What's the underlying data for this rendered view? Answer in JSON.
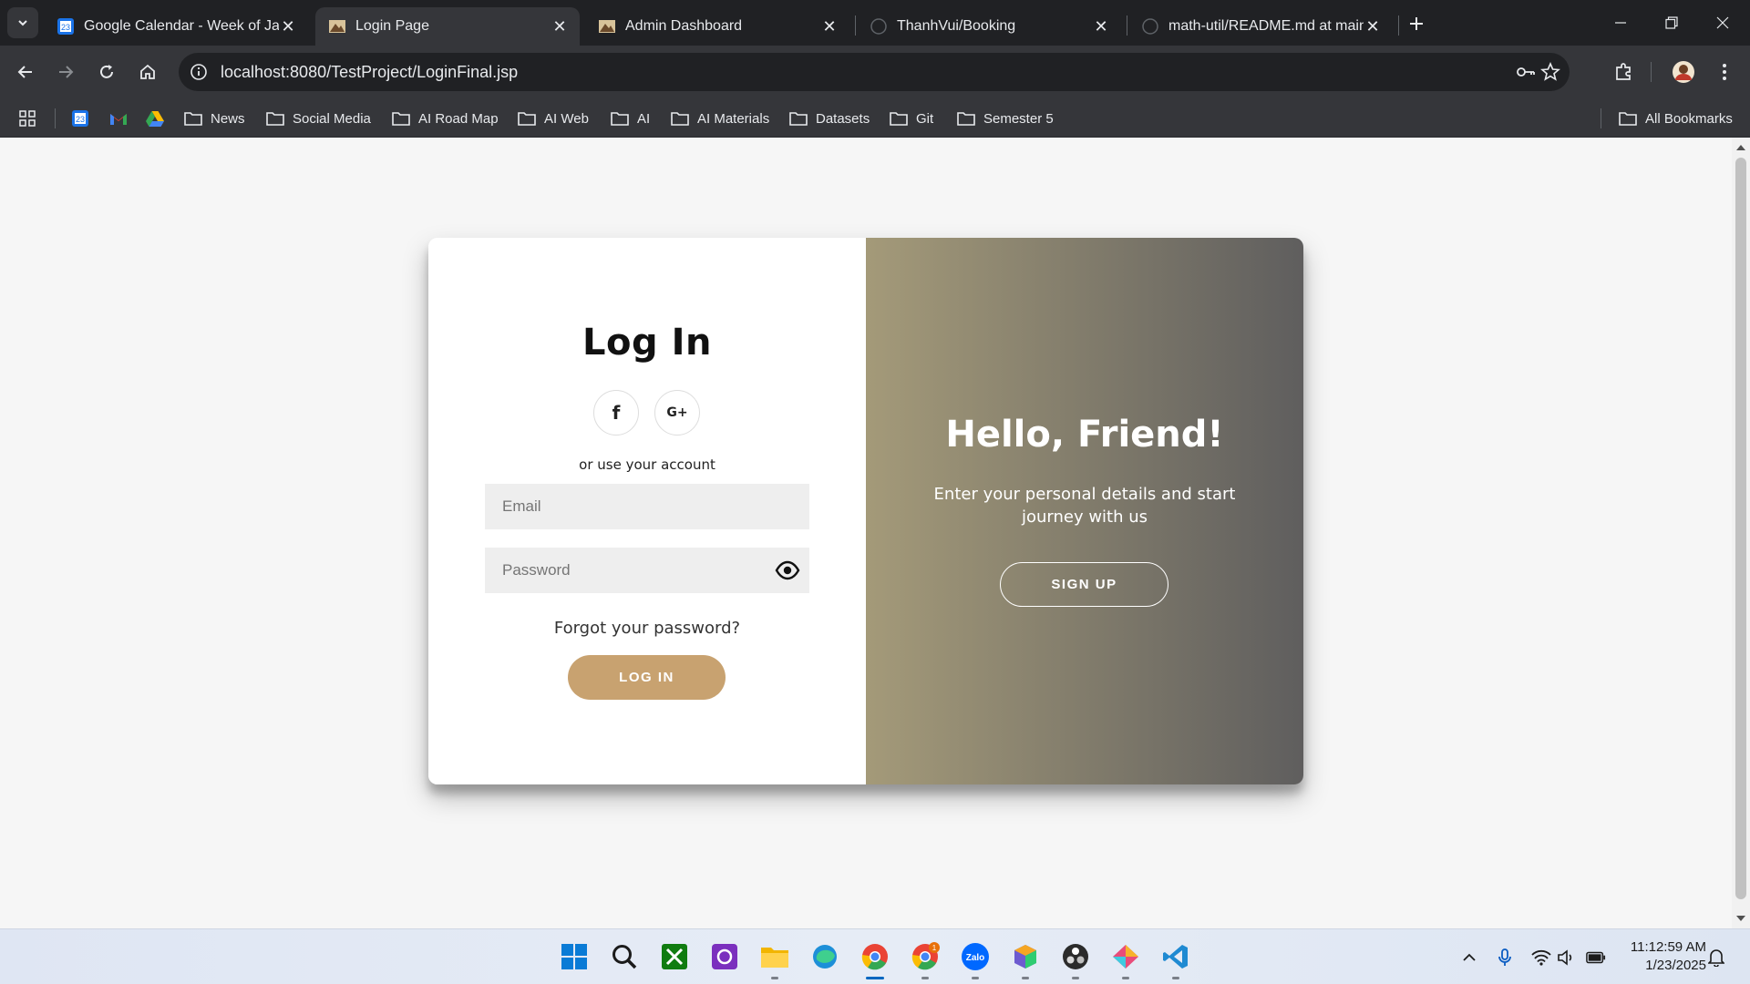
{
  "browser": {
    "tabs": [
      {
        "title": "Google Calendar - Week of Janu",
        "favicon": "google-calendar-icon",
        "favicon_text": "23",
        "active": false
      },
      {
        "title": "Login Page",
        "favicon": "site-logo-icon",
        "active": true
      },
      {
        "title": "Admin Dashboard",
        "favicon": "site-logo-icon",
        "active": false
      },
      {
        "title": "ThanhVui/Booking",
        "favicon": "github-icon",
        "active": false
      },
      {
        "title": "math-util/README.md at main",
        "favicon": "github-icon",
        "active": false
      }
    ],
    "url": "localhost:8080/TestProject/LoginFinal.jsp",
    "bookmarks": [
      {
        "label": "News"
      },
      {
        "label": "Social Media"
      },
      {
        "label": "AI Road Map"
      },
      {
        "label": "AI Web"
      },
      {
        "label": "AI"
      },
      {
        "label": "AI Materials"
      },
      {
        "label": "Datasets"
      },
      {
        "label": "Git"
      },
      {
        "label": "Semester 5"
      }
    ],
    "all_bookmarks_label": "All Bookmarks",
    "calendar_bookmark_text": "23"
  },
  "login": {
    "title": "Log In",
    "social": [
      {
        "label": "f",
        "icon": "facebook-icon"
      },
      {
        "label": "G+",
        "icon": "google-plus-icon"
      }
    ],
    "or_text": "or use your account",
    "email_placeholder": "Email",
    "password_placeholder": "Password",
    "forgot_text": "Forgot your password?",
    "button_label": "LOG IN",
    "accent_color": "#c8a270"
  },
  "welcome": {
    "title": "Hello, Friend!",
    "subtitle": "Enter your personal details and start journey with us",
    "button_label": "SIGN UP",
    "gradient": [
      "#a49a79",
      "#5f5e5e"
    ]
  },
  "taskbar": {
    "apps": [
      "windows-start-icon",
      "search-icon",
      "xbox-icon",
      "photo-app-icon",
      "file-explorer-icon",
      "edge-icon",
      "chrome-icon",
      "chrome-profile-icon",
      "zalo-icon",
      "cube-app-icon",
      "obs-icon",
      "gem-app-icon",
      "vscode-icon"
    ],
    "zalo_label": "Zalo",
    "chrome_badge": "1",
    "time": "11:12:59 AM",
    "date": "1/23/2025"
  }
}
